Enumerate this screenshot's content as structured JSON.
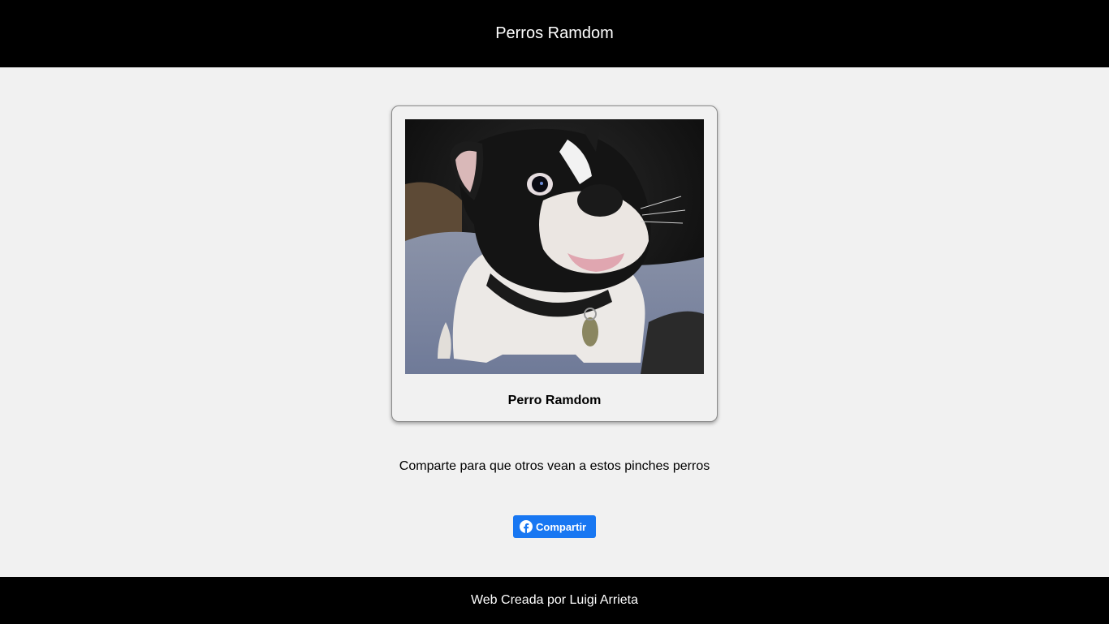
{
  "header": {
    "title": "Perros Ramdom"
  },
  "card": {
    "image_subject": "french-bulldog-photo",
    "title": "Perro Ramdom"
  },
  "share": {
    "text": "Comparte para que otros vean a estos pinches perros",
    "button_label": "Compartir",
    "button_icon": "facebook-icon",
    "button_color": "#1877f2"
  },
  "footer": {
    "text": "Web Creada por Luigi Arrieta"
  },
  "colors": {
    "bars": "#000000",
    "background": "#f1f1f1"
  }
}
